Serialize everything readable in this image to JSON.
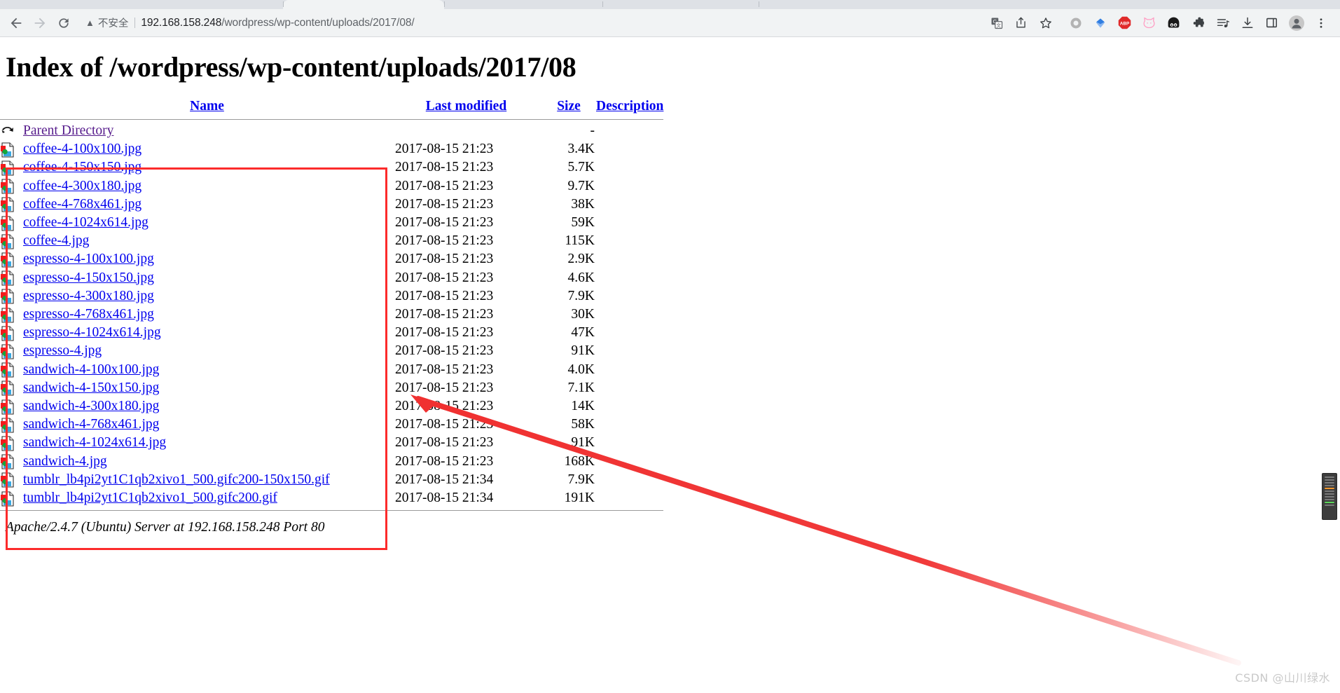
{
  "browser": {
    "back_label": "Back",
    "forward_label": "Forward",
    "reload_label": "Reload",
    "security_label": "不安全",
    "url_host": "192.168.158.248",
    "url_path": "/wordpress/wp-content/uploads/2017/08/",
    "toolbar_icons": [
      {
        "name": "translate-icon",
        "label": "Translate"
      },
      {
        "name": "share-icon",
        "label": "Share"
      },
      {
        "name": "bookmark-star-icon",
        "label": "Bookmark this tab"
      },
      {
        "name": "extension-ring-icon",
        "label": "Extension"
      },
      {
        "name": "extension-diamond-icon",
        "label": "Extension"
      },
      {
        "name": "adblock-plus-icon",
        "label": "ABP"
      },
      {
        "name": "cat-extension-icon",
        "label": "Extension"
      },
      {
        "name": "panda-extension-icon",
        "label": "Extension"
      },
      {
        "name": "extensions-puzzle-icon",
        "label": "Extensions"
      },
      {
        "name": "media-playlist-icon",
        "label": "Media"
      },
      {
        "name": "downloads-icon",
        "label": "Downloads"
      },
      {
        "name": "side-panel-icon",
        "label": "Side panel"
      },
      {
        "name": "profile-avatar-icon",
        "label": "Profile"
      },
      {
        "name": "chrome-menu-icon",
        "label": "Customize and control Google Chrome"
      }
    ]
  },
  "page": {
    "title": "Index of /wordpress/wp-content/uploads/2017/08",
    "footer": "Apache/2.4.7 (Ubuntu) Server at 192.168.158.248 Port 80",
    "columns": {
      "name": "Name",
      "last_modified": "Last modified",
      "size": "Size",
      "description": "Description"
    },
    "rows": [
      {
        "icon": "parent-directory-icon",
        "name": "Parent Directory",
        "visited": true,
        "date": "",
        "size": "-",
        "desc": ""
      },
      {
        "icon": "image-file-icon",
        "name": "coffee-4-100x100.jpg",
        "visited": false,
        "date": "2017-08-15 21:23",
        "size": "3.4K",
        "desc": ""
      },
      {
        "icon": "image-file-icon",
        "name": "coffee-4-150x150.jpg",
        "visited": false,
        "date": "2017-08-15 21:23",
        "size": "5.7K",
        "desc": ""
      },
      {
        "icon": "image-file-icon",
        "name": "coffee-4-300x180.jpg",
        "visited": false,
        "date": "2017-08-15 21:23",
        "size": "9.7K",
        "desc": ""
      },
      {
        "icon": "image-file-icon",
        "name": "coffee-4-768x461.jpg",
        "visited": false,
        "date": "2017-08-15 21:23",
        "size": "38K",
        "desc": ""
      },
      {
        "icon": "image-file-icon",
        "name": "coffee-4-1024x614.jpg",
        "visited": false,
        "date": "2017-08-15 21:23",
        "size": "59K",
        "desc": ""
      },
      {
        "icon": "image-file-icon",
        "name": "coffee-4.jpg",
        "visited": false,
        "date": "2017-08-15 21:23",
        "size": "115K",
        "desc": ""
      },
      {
        "icon": "image-file-icon",
        "name": "espresso-4-100x100.jpg",
        "visited": false,
        "date": "2017-08-15 21:23",
        "size": "2.9K",
        "desc": ""
      },
      {
        "icon": "image-file-icon",
        "name": "espresso-4-150x150.jpg",
        "visited": false,
        "date": "2017-08-15 21:23",
        "size": "4.6K",
        "desc": ""
      },
      {
        "icon": "image-file-icon",
        "name": "espresso-4-300x180.jpg",
        "visited": false,
        "date": "2017-08-15 21:23",
        "size": "7.9K",
        "desc": ""
      },
      {
        "icon": "image-file-icon",
        "name": "espresso-4-768x461.jpg",
        "visited": false,
        "date": "2017-08-15 21:23",
        "size": "30K",
        "desc": ""
      },
      {
        "icon": "image-file-icon",
        "name": "espresso-4-1024x614.jpg",
        "visited": false,
        "date": "2017-08-15 21:23",
        "size": "47K",
        "desc": ""
      },
      {
        "icon": "image-file-icon",
        "name": "espresso-4.jpg",
        "visited": false,
        "date": "2017-08-15 21:23",
        "size": "91K",
        "desc": ""
      },
      {
        "icon": "image-file-icon",
        "name": "sandwich-4-100x100.jpg",
        "visited": false,
        "date": "2017-08-15 21:23",
        "size": "4.0K",
        "desc": ""
      },
      {
        "icon": "image-file-icon",
        "name": "sandwich-4-150x150.jpg",
        "visited": false,
        "date": "2017-08-15 21:23",
        "size": "7.1K",
        "desc": ""
      },
      {
        "icon": "image-file-icon",
        "name": "sandwich-4-300x180.jpg",
        "visited": false,
        "date": "2017-08-15 21:23",
        "size": "14K",
        "desc": ""
      },
      {
        "icon": "image-file-icon",
        "name": "sandwich-4-768x461.jpg",
        "visited": false,
        "date": "2017-08-15 21:23",
        "size": "58K",
        "desc": ""
      },
      {
        "icon": "image-file-icon",
        "name": "sandwich-4-1024x614.jpg",
        "visited": false,
        "date": "2017-08-15 21:23",
        "size": "91K",
        "desc": ""
      },
      {
        "icon": "image-file-icon",
        "name": "sandwich-4.jpg",
        "visited": false,
        "date": "2017-08-15 21:23",
        "size": "168K",
        "desc": ""
      },
      {
        "icon": "image-file-icon",
        "name": "tumblr_lb4pi2yt1C1qb2xivo1_500.gifc200-150x150.gif",
        "visited": false,
        "date": "2017-08-15 21:34",
        "size": "7.9K",
        "desc": ""
      },
      {
        "icon": "image-file-icon",
        "name": "tumblr_lb4pi2yt1C1qb2xivo1_500.gifc200.gif",
        "visited": false,
        "date": "2017-08-15 21:34",
        "size": "191K",
        "desc": ""
      }
    ]
  },
  "annotations": {
    "box_color": "#fc2b2b",
    "arrow_color": "#f03030"
  },
  "watermark": "CSDN @山川绿水"
}
